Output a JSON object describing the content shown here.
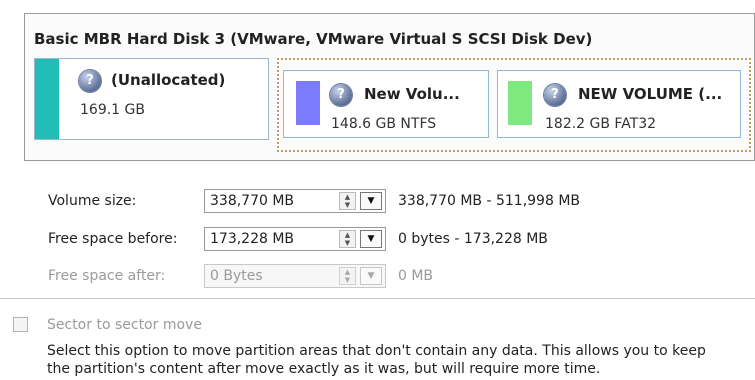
{
  "disk": {
    "header": "Basic MBR Hard Disk 3 (VMware, VMware Virtual S SCSI Disk Dev)",
    "partitions": [
      {
        "name": "(Unallocated)",
        "size": "169.1 GB",
        "color": "#1fbfb8"
      },
      {
        "name": "New Volu...",
        "size": "148.6 GB NTFS",
        "color": "#7b7bff"
      },
      {
        "name": "NEW VOLUME (...",
        "size": "182.2 GB FAT32",
        "color": "#7fe87f"
      }
    ]
  },
  "fields": {
    "volume_size": {
      "label": "Volume size:",
      "value": "338,770 MB",
      "range": "338,770 MB - 511,998 MB"
    },
    "free_before": {
      "label": "Free space before:",
      "value": "173,228 MB",
      "range": "0 bytes - 173,228 MB"
    },
    "free_after": {
      "label": "Free space after:",
      "value": "0 Bytes",
      "range": "0 MB"
    }
  },
  "sector_move": {
    "label": "Sector to sector move",
    "checked": false,
    "description_line1": "Select this option to move partition areas that don't contain any data. This allows you to keep",
    "description_line2": "the partition's content after move exactly as it was, but will require more time."
  }
}
